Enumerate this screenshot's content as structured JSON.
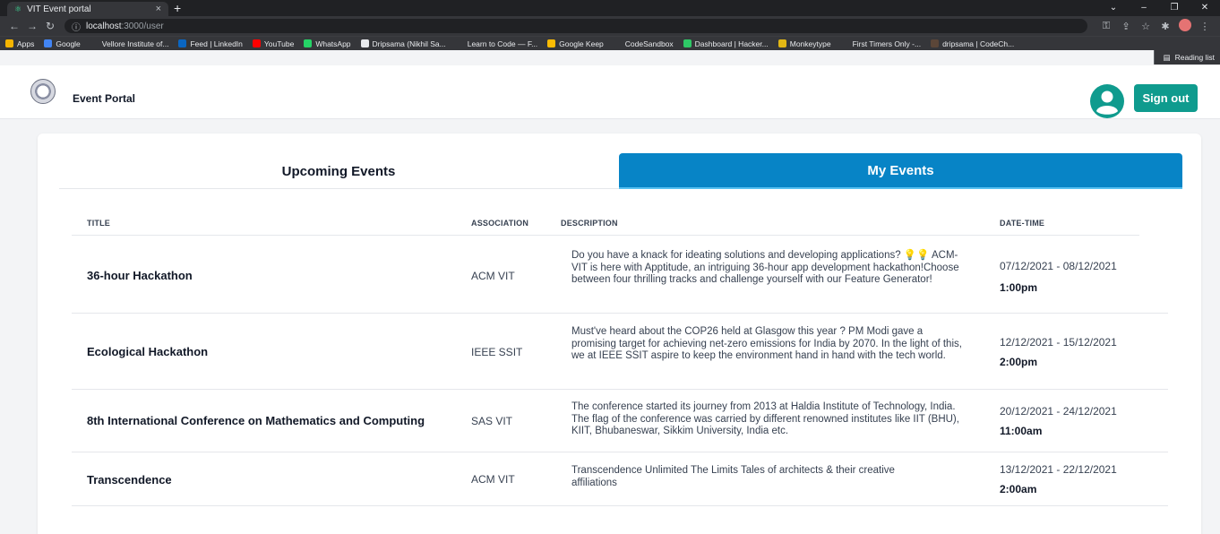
{
  "browser": {
    "tab_title": "VIT Event portal",
    "tab_close": "×",
    "new_tab": "+",
    "url_host": "localhost",
    "url_path": ":3000/user",
    "bookmarks": [
      {
        "label": "Apps",
        "color": "#f4b400"
      },
      {
        "label": "Google",
        "color": "#4285f4"
      },
      {
        "label": "Vellore Institute of...",
        "color": "#35363a"
      },
      {
        "label": "Feed | LinkedIn",
        "color": "#0a66c2"
      },
      {
        "label": "YouTube",
        "color": "#ff0000"
      },
      {
        "label": "WhatsApp",
        "color": "#25d366"
      },
      {
        "label": "Dripsama (Nikhil Sa...",
        "color": "#e8eaed"
      },
      {
        "label": "Learn to Code — F...",
        "color": "#35363a"
      },
      {
        "label": "Google Keep",
        "color": "#fbbc04"
      },
      {
        "label": "CodeSandbox",
        "color": "#35363a"
      },
      {
        "label": "Dashboard | Hacker...",
        "color": "#2ec866"
      },
      {
        "label": "Monkeytype",
        "color": "#e2b714"
      },
      {
        "label": "First Timers Only -...",
        "color": "#35363a"
      },
      {
        "label": "dripsama | CodeCh...",
        "color": "#5b4638"
      }
    ],
    "reading_list": "Reading list"
  },
  "header": {
    "brand": "Event Portal",
    "sign_out": "Sign out"
  },
  "tabs": {
    "upcoming": "Upcoming Events",
    "mine": "My Events"
  },
  "columns": {
    "title": "TITLE",
    "association": "ASSOCIATION",
    "description": "DESCRIPTION",
    "datetime": "DATE-TIME"
  },
  "events": [
    {
      "title": "36-hour Hackathon",
      "association": "ACM VIT",
      "description": "Do you have a knack for ideating solutions and developing applications? 💡💡 ACM-VIT is here with Apptitude, an intriguing 36-hour app development hackathon!Choose between four thrilling tracks and challenge yourself with our Feature Generator!",
      "dates": "07/12/2021 - 08/12/2021",
      "time": "1:00pm"
    },
    {
      "title": "Ecological Hackathon",
      "association": "IEEE SSIT",
      "description": "Must've heard about the COP26 held at Glasgow this year ? PM Modi gave a promising target for achieving net-zero emissions for India by 2070. In the light of this, we at IEEE SSIT aspire to keep the environment hand in hand with the tech world.",
      "dates": "12/12/2021 - 15/12/2021",
      "time": "2:00pm"
    },
    {
      "title": "8th International Conference on Mathematics and Computing",
      "association": "SAS VIT",
      "description": "The conference started its journey from 2013 at Haldia Institute of Technology, India. The flag of the conference was carried by different renowned institutes like IIT (BHU), KIIT, Bhubaneswar, Sikkim University, India etc.",
      "dates": "20/12/2021 - 24/12/2021",
      "time": "11:00am"
    },
    {
      "title": "Transcendence",
      "association": "ACM VIT",
      "description": "Transcendence Unlimited The Limits Tales of architects & their creative affiliations",
      "dates": "13/12/2021 - 22/12/2021",
      "time": "2:00am"
    }
  ],
  "colors": {
    "accent": "#0784c6",
    "sign_out": "#0f9b8e"
  }
}
